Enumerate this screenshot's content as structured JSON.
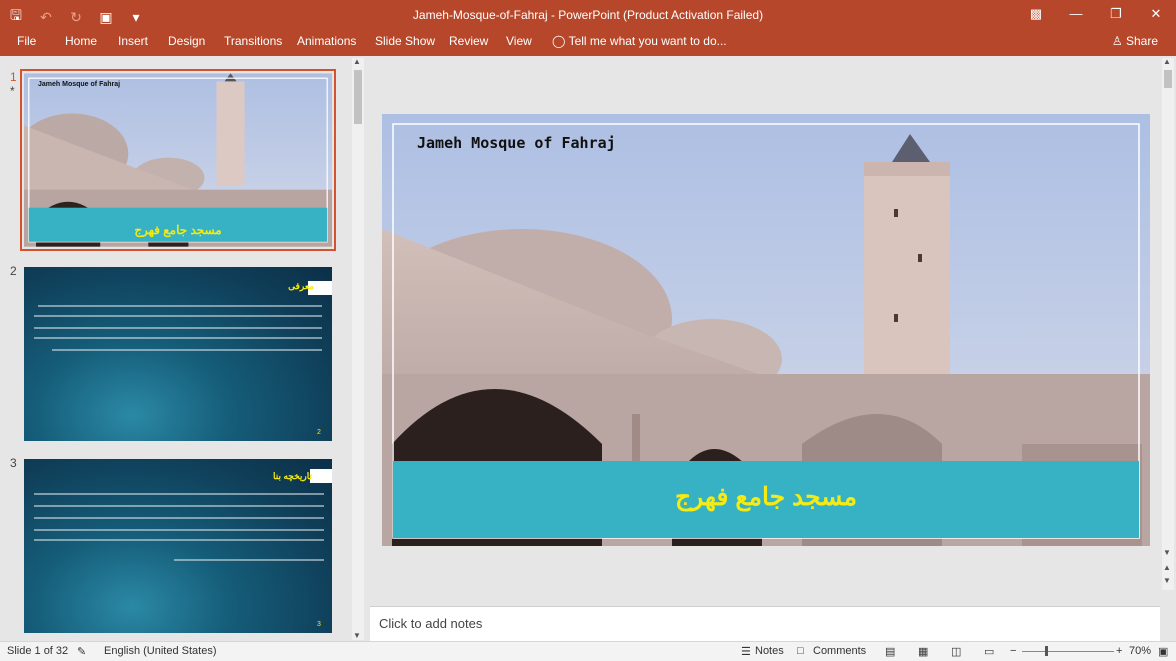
{
  "app": {
    "window_title": "Jameh-Mosque-of-Fahraj - PowerPoint (Product Activation Failed)",
    "qat_icons": [
      "save-icon",
      "undo-icon",
      "redo-icon",
      "presenter-icon",
      "customize-icon"
    ]
  },
  "ribbon": {
    "tabs": [
      "File",
      "Home",
      "Insert",
      "Design",
      "Transitions",
      "Animations",
      "Slide Show",
      "Review",
      "View"
    ],
    "tell_me": "Tell me what you want to do...",
    "share": "Share"
  },
  "thumbnails": [
    {
      "number": "1",
      "marker": "*",
      "title": "Jameh Mosque of Fahraj",
      "caption": "مسجد جامع فهرج"
    },
    {
      "number": "2",
      "heading": "معرفی",
      "page": "2"
    },
    {
      "number": "3",
      "heading": "تاریخچه بنا",
      "page": "3"
    }
  ],
  "slide": {
    "title": "Jameh Mosque of Fahraj",
    "caption": "مسجد جامع فهرج"
  },
  "notes": {
    "placeholder": "Click to add notes"
  },
  "status": {
    "slide_info": "Slide 1 of 32",
    "language": "English (United States)",
    "notes": "Notes",
    "comments": "Comments",
    "zoom": "70%"
  },
  "colors": {
    "ribbon": "#b7472a",
    "caption_band": "#37b2c4",
    "caption_text": "#f4ea14",
    "selection": "#d35230"
  }
}
